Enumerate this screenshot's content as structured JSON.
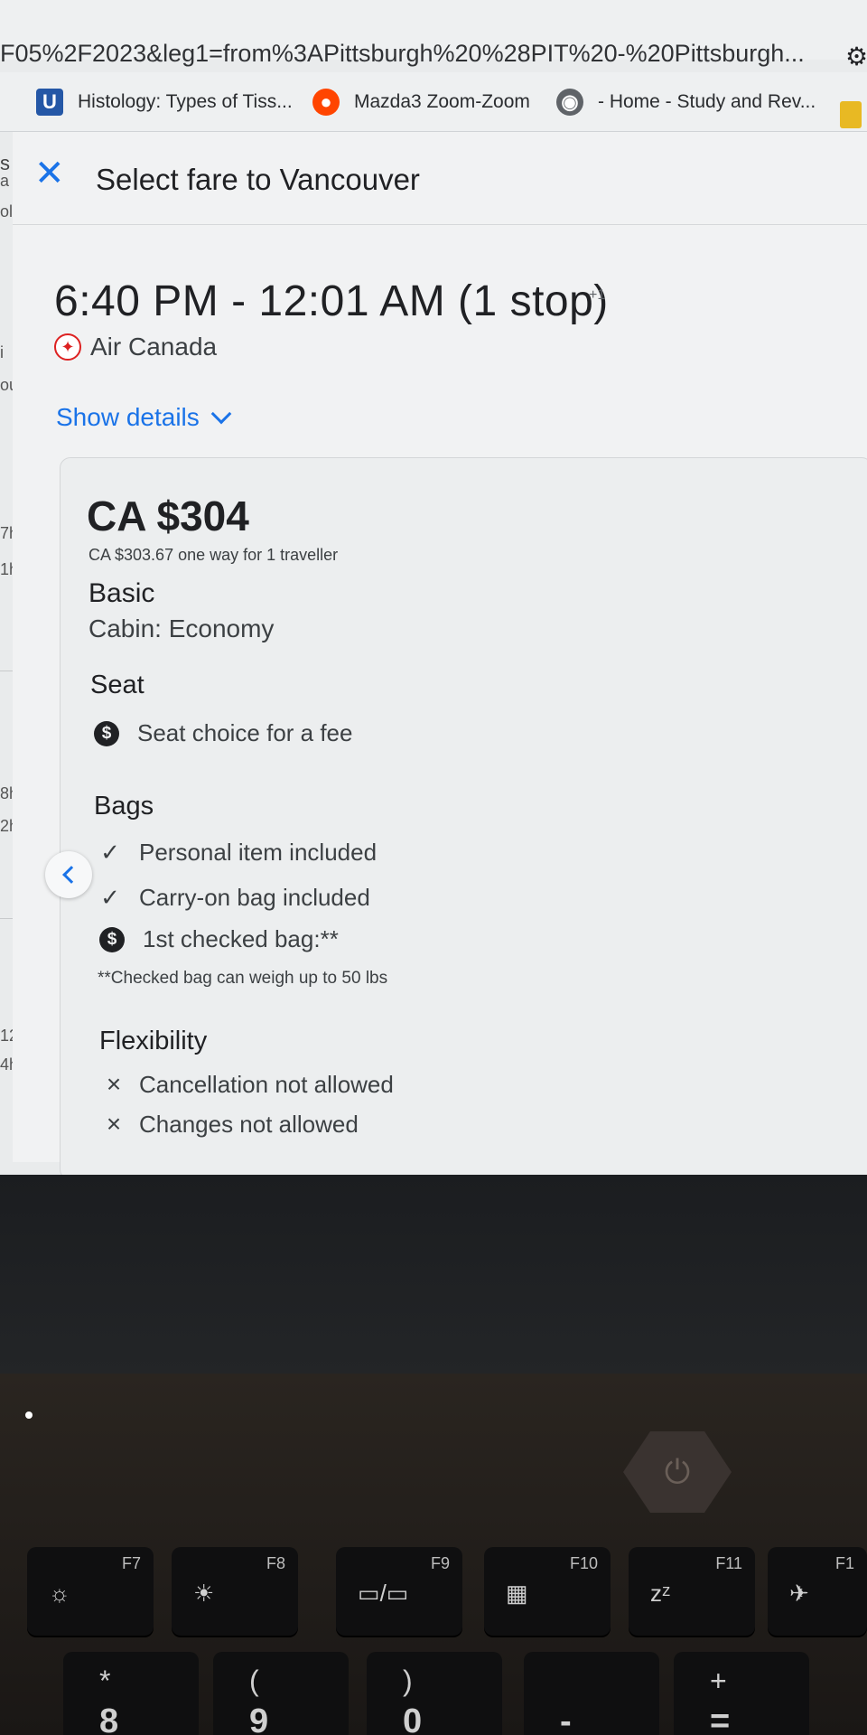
{
  "browser": {
    "url": "F05%2F2023&leg1=from%3APittsburgh%20%28PIT%20-%20Pittsburgh...",
    "bookmarks": [
      {
        "label": "Histology: Types of Tiss...",
        "icon": "u-logo-icon"
      },
      {
        "label": "Mazda3 Zoom-Zoom",
        "icon": "reddit-icon"
      },
      {
        "label": "- Home - Study and Rev...",
        "icon": "globe-icon"
      }
    ]
  },
  "background_fragments": [
    "a",
    "ol",
    "i",
    "ou",
    "7h",
    "1h",
    "8h",
    "2h",
    "12",
    "4h"
  ],
  "dialog": {
    "title": "Select fare to Vancouver",
    "flight_time": "6:40 PM - 12:01 AM (1 stop)",
    "day_offset": "+1",
    "airline": "Air Canada",
    "show_details": "Show details"
  },
  "fare": {
    "price": "CA $304",
    "price_detail": "CA $303.67 one way for 1 traveller",
    "name": "Basic",
    "cabin": "Cabin: Economy",
    "seat_heading": "Seat",
    "seat_item": "Seat choice for a fee",
    "bags_heading": "Bags",
    "bag_items": [
      "Personal item included",
      "Carry-on bag included",
      "1st checked bag:**"
    ],
    "bag_note": "**Checked bag can weigh up to 50 lbs",
    "flex_heading": "Flexibility",
    "flex_items": [
      "Cancellation not allowed",
      "Changes not allowed"
    ]
  },
  "keyboard": {
    "fkeys": [
      "F7",
      "F8",
      "F9",
      "F10",
      "F11",
      "F1"
    ],
    "numkeys": [
      {
        "top": "*",
        "bottom": "8"
      },
      {
        "top": "(",
        "bottom": "9"
      },
      {
        "top": ")",
        "bottom": "0"
      },
      {
        "top": "",
        "bottom": "-"
      },
      {
        "top": "+",
        "bottom": "="
      }
    ]
  }
}
